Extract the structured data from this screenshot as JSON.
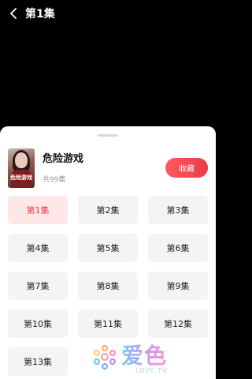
{
  "header": {
    "title": "第1集"
  },
  "drama": {
    "title": "危险游戏",
    "episode_count": "共99集",
    "favorite_label": "收藏"
  },
  "episodes": [
    "第1集",
    "第2集",
    "第3集",
    "第4集",
    "第5集",
    "第6集",
    "第7集",
    "第8集",
    "第9集",
    "第10集",
    "第11集",
    "第12集",
    "第13集"
  ],
  "active_episode": "第1集",
  "colors": {
    "accent": "#f0404a",
    "active_bg": "#fde8e7",
    "tile_bg": "#f4f4f4"
  },
  "watermark": {
    "text": "爱色",
    "sub": "LOVE TV"
  }
}
